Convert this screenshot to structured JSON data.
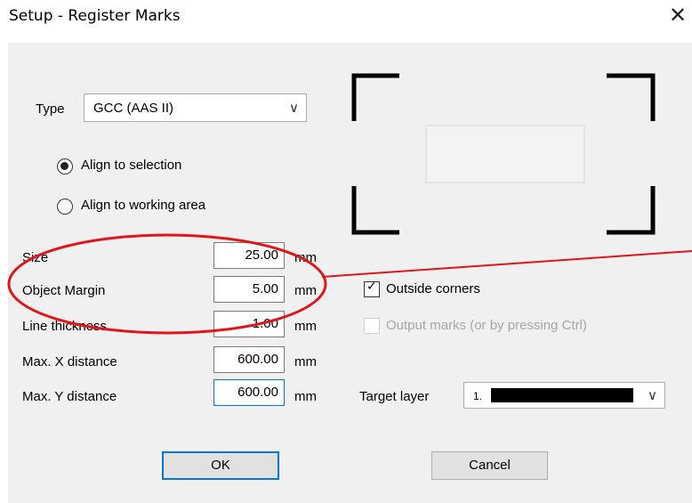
{
  "window": {
    "title": "Setup - Register Marks",
    "close_icon": "close-icon"
  },
  "type": {
    "label": "Type",
    "value": "GCC (AAS II)",
    "arrow": "∨"
  },
  "align": {
    "selection_label": "Align to selection",
    "selection_checked": true,
    "working_area_label": "Align to working area",
    "working_area_checked": false
  },
  "fields": [
    {
      "label": "Size",
      "value": "25.00",
      "unit": "mm"
    },
    {
      "label": "Object Margin",
      "value": "5.00",
      "unit": "mm"
    },
    {
      "label": "Line thickness",
      "value": "1.00",
      "unit": "mm"
    },
    {
      "label": "Max. X distance",
      "value": "600.00",
      "unit": "mm"
    },
    {
      "label": "Max. Y distance",
      "value": "600.00",
      "unit": "mm"
    }
  ],
  "options": {
    "outside_corners_label": "Outside corners",
    "outside_corners_checked": true,
    "output_marks_label": "Output marks (or by pressing Ctrl)",
    "output_marks_checked": false,
    "output_marks_enabled": false
  },
  "target_layer": {
    "label": "Target layer",
    "value": "1.",
    "arrow": "∨"
  },
  "buttons": {
    "ok": "OK",
    "cancel": "Cancel"
  },
  "annotation": {
    "color": "#e0161b"
  }
}
